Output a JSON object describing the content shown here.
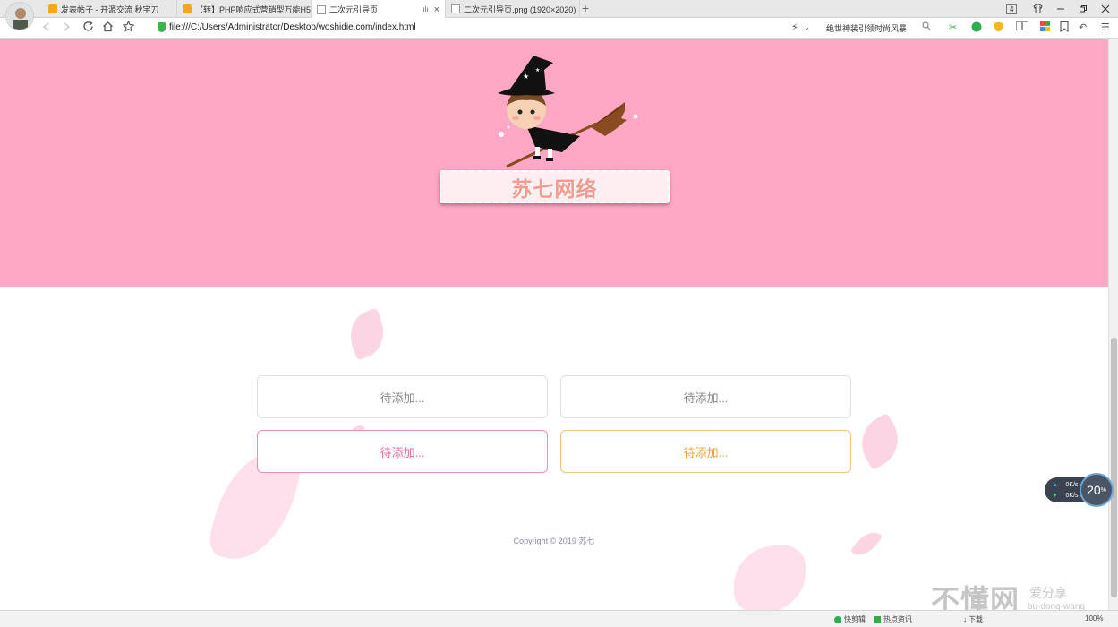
{
  "browser": {
    "tabs": [
      {
        "label": "发表帖子 - 开源交流 秋宇刀",
        "favicon": "orange-favicon"
      },
      {
        "label": "【转】PHP响应式营销型万能H5",
        "favicon": "orange-favicon"
      },
      {
        "label": "二次元引导页",
        "favicon": "page-icon",
        "active": true,
        "mute": "ılı",
        "close": "×"
      },
      {
        "label": "二次元引导页.png (1920×2020)",
        "favicon": "page-icon"
      }
    ],
    "new_tab": "+",
    "window_badge": "4",
    "url": "file:///C:/Users/Administrator/Desktop/woshidie.com/index.html",
    "search_text": "绝世神装引领时尚风暴"
  },
  "page": {
    "brand": "苏七网络",
    "cards": [
      {
        "label": "待添加...",
        "style": "gray"
      },
      {
        "label": "待添加...",
        "style": "gray"
      },
      {
        "label": "待添加...",
        "style": "pink"
      },
      {
        "label": "待添加...",
        "style": "orange"
      }
    ],
    "copyright": "Copyright © 2019 苏七",
    "hero_color": "#fea8c6"
  },
  "speed_widget": {
    "up": "0K/s",
    "down": "0K/s",
    "percent": "20",
    "percent_unit": "%"
  },
  "statusbar": {
    "items": [
      "快剪辑",
      "热点资讯",
      "下载"
    ],
    "zoom": "100%"
  },
  "watermark": {
    "main": "不懂网",
    "sub": "爱分享",
    "url": "bu-dong-wang"
  }
}
